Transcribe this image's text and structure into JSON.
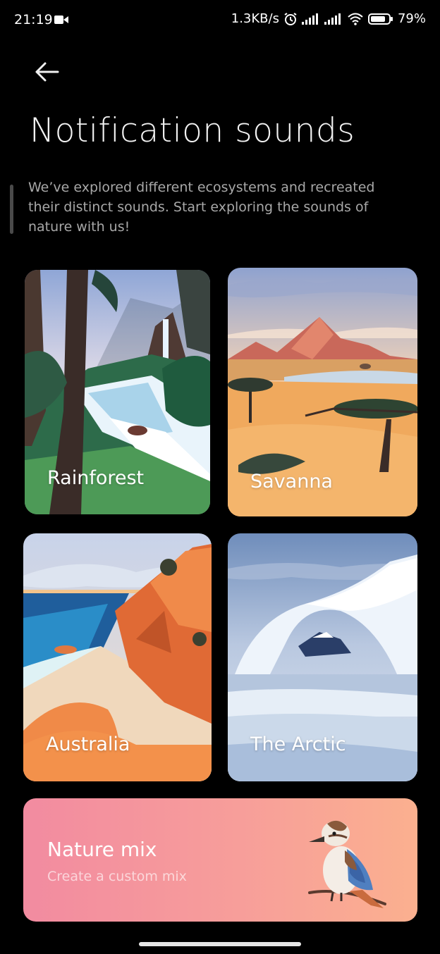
{
  "status_bar": {
    "time": "21:19",
    "speed": "1.3KB/s",
    "battery": "79%",
    "icons": [
      "video-icon",
      "alarm-icon",
      "signal-icon",
      "signal-icon",
      "wifi-icon",
      "battery-icon"
    ]
  },
  "header": {
    "title": "Notification sounds",
    "back_icon": "back-arrow-icon"
  },
  "intro": "We’ve explored different ecosystems and recreated their distinct sounds. Start exploring the sounds of nature with us!",
  "cards": [
    {
      "label": "Rainforest"
    },
    {
      "label": "Savanna"
    },
    {
      "label": "Australia"
    },
    {
      "label": "The Arctic"
    }
  ],
  "nature_mix": {
    "title": "Nature mix",
    "subtitle": "Create a custom mix"
  }
}
